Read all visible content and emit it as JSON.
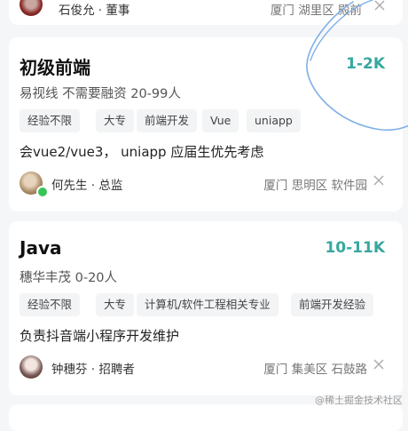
{
  "top_card": {
    "person": "石俊允 · 董事",
    "location": "厦门 湖里区 殿前"
  },
  "jobs": [
    {
      "title": "初级前端",
      "salary": "1-2K",
      "company": "易视线 不需要融资 20-99人",
      "tags": [
        "经验不限",
        "大专",
        "前端开发",
        "Vue",
        "uniapp"
      ],
      "description": "会vue2/vue3， uniapp 应届生优先考虑",
      "person": "何先生 · 总监",
      "location": "厦门 思明区 软件园",
      "online": true
    },
    {
      "title": "Java",
      "salary": "10-11K",
      "company": "穗华丰茂 0-20人",
      "tags": [
        "经验不限",
        "大专",
        "计算机/软件工程相关专业",
        "前端开发经验"
      ],
      "description": "负责抖音端小程序开发维护",
      "person": "钟穗芬 · 招聘者",
      "location": "厦门 集美区 石鼓路",
      "online": false
    }
  ],
  "watermark": "@稀土掘金技术社区",
  "colors": {
    "salary": "#36a89f",
    "background": "#f5f6f8",
    "card": "#ffffff",
    "tag_bg": "#f3f4f6",
    "online_dot": "#39c45a",
    "scribble": "#7fb0e6"
  },
  "icons": [
    "close-icon",
    "avatar",
    "online-status-icon"
  ]
}
